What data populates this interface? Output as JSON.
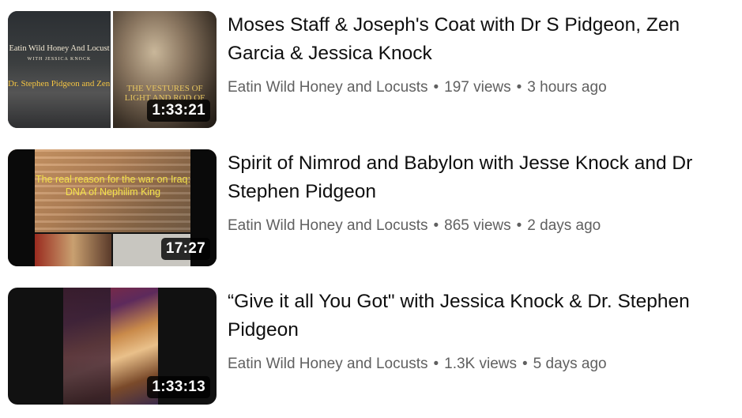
{
  "videos": [
    {
      "title": "Moses Staff & Joseph's Coat with Dr S Pidgeon, Zen Garcia & Jessica Knock",
      "channel": "Eatin Wild Honey and Locusts",
      "views": "197 views",
      "age": "3 hours ago",
      "duration": "1:33:21",
      "thumb_text": {
        "line1": "Eatin Wild Honey And Locust",
        "line2": "WITH JESSICA KNOCK",
        "line3": "Dr. Stephen Pidgeon and Zen Garcia",
        "line4": "THE VESTURES OF LIGHT AND ROD OF"
      }
    },
    {
      "title": "Spirit of Nimrod and Babylon with Jesse Knock and Dr Stephen Pidgeon",
      "channel": "Eatin Wild Honey and Locusts",
      "views": "865 views",
      "age": "2 days ago",
      "duration": "17:27",
      "thumb_text": {
        "line1": "The real reason for the war on Iraq: DNA of Nephilim King"
      }
    },
    {
      "title": "“Give it all You Got\" with Jessica Knock & Dr. Stephen Pidgeon",
      "channel": "Eatin Wild Honey and Locusts",
      "views": "1.3K views",
      "age": "5 days ago",
      "duration": "1:33:13"
    }
  ],
  "separator": "•",
  "colors": {
    "title": "#0f0f0f",
    "meta": "#606060",
    "duration_bg": "#000000cc"
  }
}
